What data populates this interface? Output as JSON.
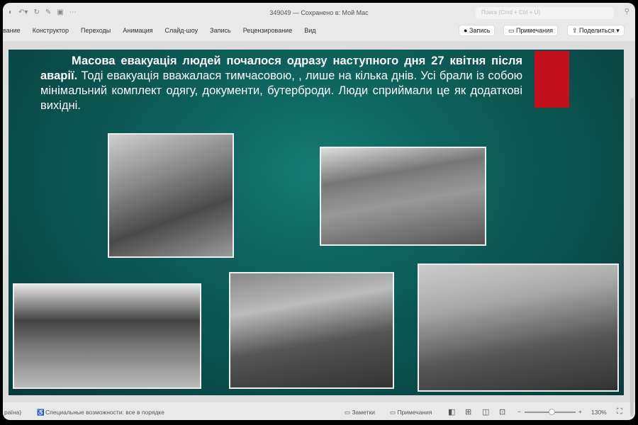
{
  "title": "349049 — Сохранено в: Мой Mac",
  "search_placeholder": "Поиск (Cmd + Ctrl + U)",
  "menu": [
    "вание",
    "Конструктор",
    "Переходы",
    "Анимация",
    "Слайд-шоу",
    "Запись",
    "Рецензирование",
    "Вид"
  ],
  "buttons": {
    "record": "Запись",
    "comments": "Примечания",
    "share": "Поделиться"
  },
  "slide": {
    "bold": "Масова евакуація людей почалося одразу наступного дня 27 квітня після аварії.",
    "text": " Тоді евакуація вважалася тимчасовою, , лише на кілька днів. Усі брали із собою мінімальний комплект одягу, документи, бутерброди. Люди сприймали це як додаткові вихідні.",
    "accent": "#c4101d"
  },
  "status": {
    "lang": "раїна)",
    "accessibility": "Специальные возможности: все в порядке",
    "notes": "Заметки",
    "comments": "Примечания",
    "zoom": "130%"
  }
}
